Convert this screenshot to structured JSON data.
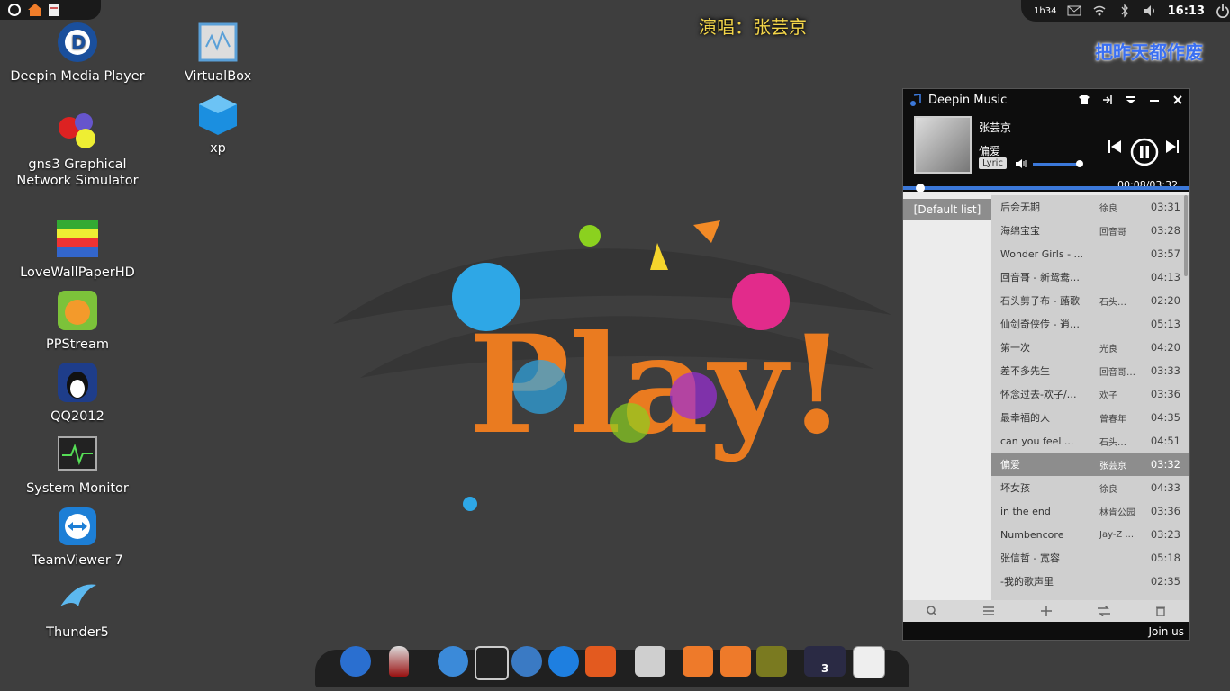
{
  "colors": {
    "accent": "#3b78d9",
    "lyric_top": "#f4d64a",
    "lyric_right": "#3a6ff2"
  },
  "top_panel": {
    "clock": "16:13",
    "indicator_text": "1h34"
  },
  "desktop_icons": [
    {
      "label": "Deepin Media Player",
      "icon": "deepin-media-player-icon"
    },
    {
      "label": "gns3 Graphical Network Simulator",
      "icon": "gns3-icon"
    },
    {
      "label": "LoveWallPaperHD",
      "icon": "wallpaper-icon"
    },
    {
      "label": "PPStream",
      "icon": "ppstream-icon"
    },
    {
      "label": "QQ2012",
      "icon": "qq-penguin-icon"
    },
    {
      "label": "System Monitor",
      "icon": "system-monitor-icon"
    },
    {
      "label": "TeamViewer 7",
      "icon": "teamviewer-icon"
    },
    {
      "label": "Thunder5",
      "icon": "thunder-icon"
    },
    {
      "label": "VirtualBox",
      "icon": "virtualbox-icon"
    },
    {
      "label": "xp",
      "icon": "vbox-cube-icon"
    }
  ],
  "lyrics": {
    "top": "演唱：张芸京",
    "right": "把昨天都作废"
  },
  "player": {
    "title": "Deepin Music",
    "artist": "张芸京",
    "song": "偏爱",
    "lyric_button": "Lyric",
    "time": "00:08/03:32",
    "playlist_name": "[Default list]",
    "join_us": "Join us",
    "songs": [
      {
        "title": "后会无期",
        "artist": "徐良",
        "duration": "03:31"
      },
      {
        "title": "海绵宝宝",
        "artist": "回音哥",
        "duration": "03:28"
      },
      {
        "title": "Wonder Girls - ...",
        "artist": "",
        "duration": "03:57"
      },
      {
        "title": "回音哥 - 新鸳鸯…",
        "artist": "",
        "duration": "04:13"
      },
      {
        "title": "石头剪子布 - 蕗歌",
        "artist": "石头…",
        "duration": "02:20"
      },
      {
        "title": "仙剑奇侠传 - 逍…",
        "artist": "",
        "duration": "05:13"
      },
      {
        "title": "第一次",
        "artist": "光良",
        "duration": "04:20"
      },
      {
        "title": "差不多先生",
        "artist": "回音哥…",
        "duration": "03:33"
      },
      {
        "title": "怀念过去-欢子/…",
        "artist": "欢子",
        "duration": "03:36"
      },
      {
        "title": "最幸福的人",
        "artist": "曾春年",
        "duration": "04:35"
      },
      {
        "title": "can you feel ...",
        "artist": "石头…",
        "duration": "04:51"
      },
      {
        "title": "偏爱",
        "artist": "张芸京",
        "duration": "03:32",
        "selected": true
      },
      {
        "title": "坏女孩",
        "artist": "徐良",
        "duration": "04:33"
      },
      {
        "title": "in the end",
        "artist": "林肯公园",
        "duration": "03:36"
      },
      {
        "title": "Numbencore",
        "artist": "Jay-Z ...",
        "duration": "03:23"
      },
      {
        "title": "张信哲 - 宽容",
        "artist": "",
        "duration": "05:18"
      },
      {
        "title": "-我的歌声里",
        "artist": "",
        "duration": "02:35"
      }
    ]
  },
  "dock": {
    "workspace_number": "3"
  }
}
